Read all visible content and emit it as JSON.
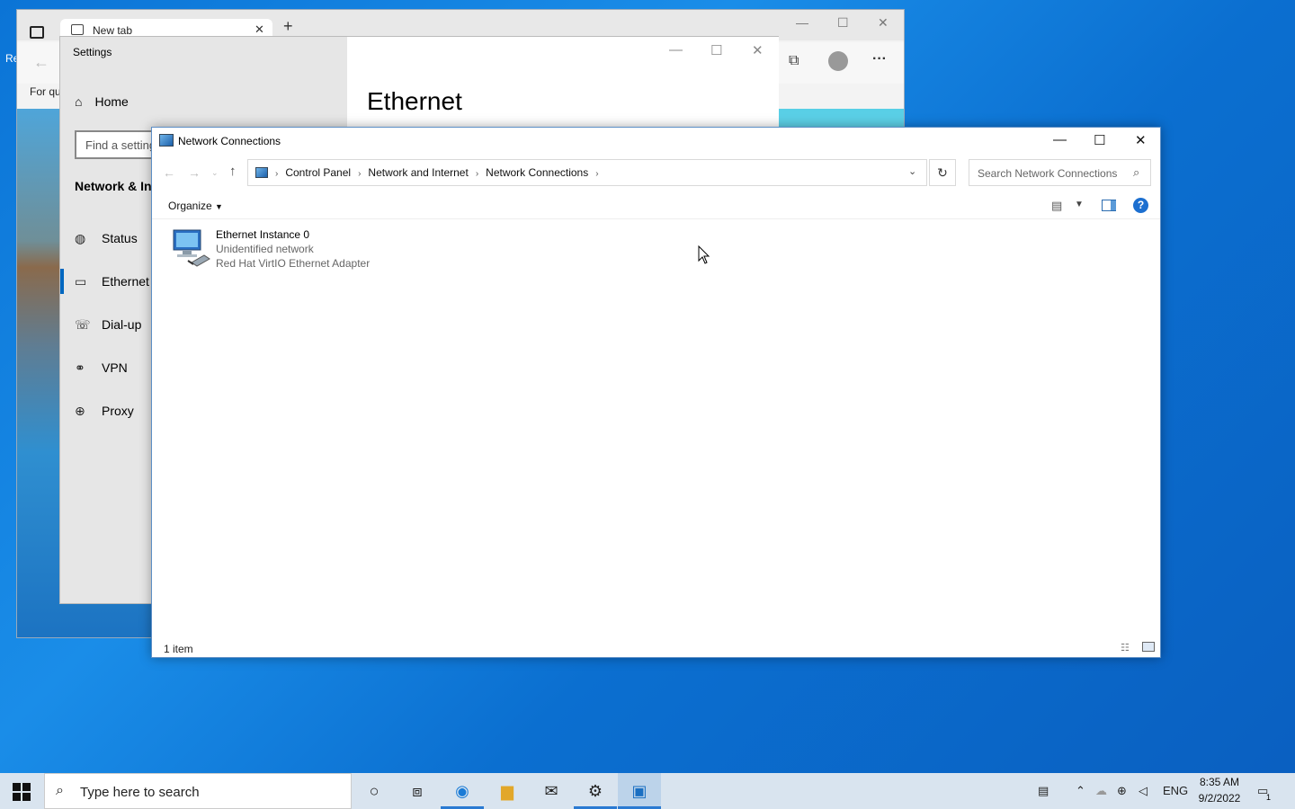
{
  "desktop": {
    "icon_label_fragment": "Re"
  },
  "edge": {
    "tab_title": "New tab",
    "tab_close": "✕",
    "new_tab": "+",
    "minimize": "—",
    "maximize": "☐",
    "close": "✕",
    "favorites_fragment": "For qu",
    "more": "···"
  },
  "settings": {
    "title": "Settings",
    "heading": "Ethernet",
    "minimize": "—",
    "maximize": "☐",
    "close": "✕",
    "home": "Home",
    "search_placeholder": "Find a setting",
    "section": "Network & Internet",
    "items": [
      "Status",
      "Ethernet",
      "Dial-up",
      "VPN",
      "Proxy"
    ]
  },
  "network_connections": {
    "title": "Network Connections",
    "minimize": "—",
    "maximize": "☐",
    "close": "✕",
    "breadcrumb": [
      "Control Panel",
      "Network and Internet",
      "Network Connections"
    ],
    "search_placeholder": "Search Network Connections",
    "organize": "Organize",
    "item": {
      "name": "Ethernet Instance 0",
      "status": "Unidentified network",
      "adapter": "Red Hat VirtIO Ethernet Adapter"
    },
    "status_count": "1 item",
    "help": "?"
  },
  "taskbar": {
    "search_placeholder": "Type here to search",
    "language": "ENG",
    "time": "8:35 AM",
    "date": "9/2/2022",
    "notification_count": "1"
  },
  "colors": {
    "accent": "#0067c0",
    "desktop": "#0b74d6",
    "taskbar": "#d9e4ef"
  }
}
